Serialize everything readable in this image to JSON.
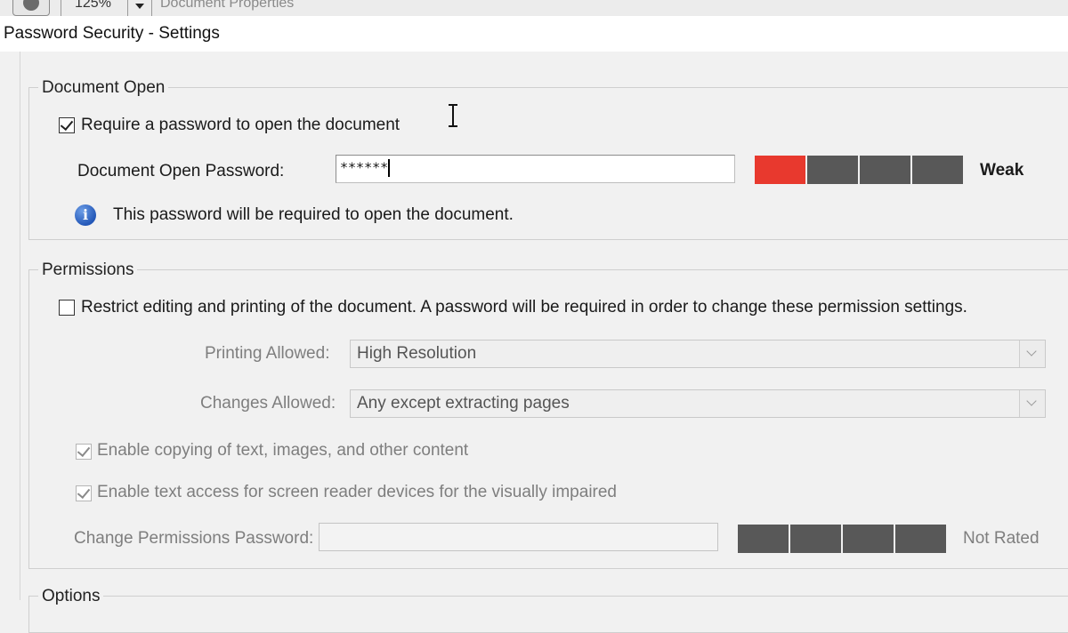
{
  "toolbar": {
    "zoom": "125%",
    "document_properties": "Document Properties"
  },
  "window": {
    "title": "Password Security - Settings"
  },
  "document_open": {
    "legend": "Document Open",
    "require_password_label": "Require a password to open the document",
    "require_password_checked": true,
    "password_label": "Document Open Password:",
    "password_value": "******",
    "strength_label": "Weak",
    "strength_segments_filled": 1,
    "strength_segments_total": 4,
    "info_text": "This password will be required to open the document."
  },
  "permissions": {
    "legend": "Permissions",
    "restrict_label": "Restrict editing and printing of the document. A password will be required in order to change these permission settings.",
    "restrict_checked": false,
    "printing_label": "Printing Allowed:",
    "printing_value": "High Resolution",
    "changes_label": "Changes Allowed:",
    "changes_value": "Any except extracting pages",
    "enable_copying_label": "Enable copying of text, images, and other content",
    "enable_copying_checked": true,
    "enable_screen_reader_label": "Enable text access for screen reader devices for the visually impaired",
    "enable_screen_reader_checked": true,
    "change_password_label": "Change Permissions Password:",
    "change_password_value": "",
    "strength_label": "Not Rated"
  },
  "options": {
    "legend": "Options"
  },
  "colors": {
    "strength_weak": "#e8392e",
    "strength_empty": "#585858",
    "info_icon": "#2458b8"
  },
  "icons": {
    "toolbar_button": "plus-circle-icon",
    "info": "info-icon",
    "select_arrow": "chevron-down-icon",
    "text_cursor": "ibeam-cursor-icon"
  }
}
